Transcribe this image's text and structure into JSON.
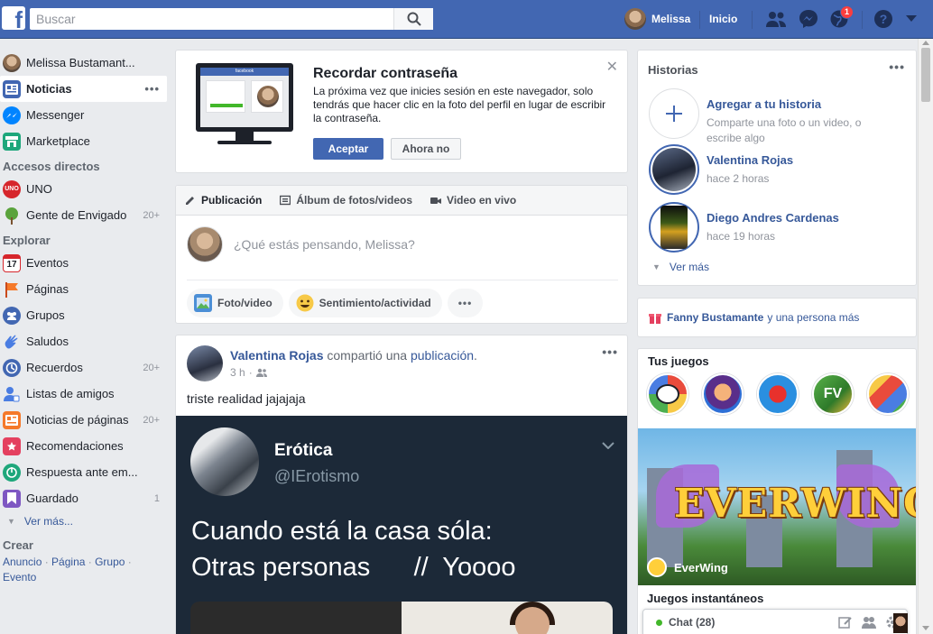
{
  "topbar": {
    "logo": "f",
    "search_placeholder": "Buscar",
    "user_name": "Melissa",
    "home_label": "Inicio",
    "notification_count": "1",
    "brand_color": "#4267b2"
  },
  "leftnav": {
    "profile_name": "Melissa Bustamant...",
    "main_items": [
      {
        "label": "Noticias",
        "icon": "news-feed-icon"
      },
      {
        "label": "Messenger",
        "icon": "messenger-icon"
      },
      {
        "label": "Marketplace",
        "icon": "marketplace-icon"
      }
    ],
    "shortcuts_title": "Accesos directos",
    "shortcuts": [
      {
        "label": "UNO",
        "icon": "uno-game-icon",
        "count": ""
      },
      {
        "label": "Gente de Envigado",
        "icon": "group-tree-icon",
        "count": "20+"
      }
    ],
    "explore_title": "Explorar",
    "explore": [
      {
        "label": "Eventos",
        "icon": "calendar-icon",
        "count": ""
      },
      {
        "label": "Páginas",
        "icon": "flag-icon",
        "count": ""
      },
      {
        "label": "Grupos",
        "icon": "groups-icon",
        "count": ""
      },
      {
        "label": "Saludos",
        "icon": "wave-icon",
        "count": ""
      },
      {
        "label": "Recuerdos",
        "icon": "memories-icon",
        "count": "20+"
      },
      {
        "label": "Listas de amigos",
        "icon": "friend-list-icon",
        "count": ""
      },
      {
        "label": "Noticias de páginas",
        "icon": "pages-feed-icon",
        "count": "20+"
      },
      {
        "label": "Recomendaciones",
        "icon": "recommendations-icon",
        "count": ""
      },
      {
        "label": "Respuesta ante em...",
        "icon": "crisis-response-icon",
        "count": ""
      },
      {
        "label": "Guardado",
        "icon": "saved-icon",
        "count": "1"
      }
    ],
    "see_more": "Ver más...",
    "create_title": "Crear",
    "create_links": [
      "Anuncio",
      "Página",
      "Grupo",
      "Evento"
    ]
  },
  "recordar": {
    "title": "Recordar contraseña",
    "body": "La próxima vez que inicies sesión en este navegador, solo tendrás que hacer clic en la foto del perfil en lugar de escribir la contraseña.",
    "accept": "Aceptar",
    "not_now": "Ahora no",
    "monitor_brand": "facebook"
  },
  "composer": {
    "tabs": [
      "Publicación",
      "Álbum de fotos/videos",
      "Video en vivo"
    ],
    "placeholder": "¿Qué estás pensando, Melissa?",
    "actions": [
      "Foto/video",
      "Sentimiento/actividad"
    ]
  },
  "post": {
    "author": "Valentina Rojas",
    "action_prefix": " compartió una ",
    "action_link": "publicación",
    "action_suffix": ".",
    "time": "3 h",
    "text": "triste realidad jajajaja",
    "tweet": {
      "name": "Erótica",
      "handle": "@IErotismo",
      "line1": "Cuando está la casa sóla:",
      "line2": "Otras personas      //  Yoooo"
    }
  },
  "historias": {
    "title": "Historias",
    "add_title": "Agregar a tu historia",
    "add_sub": "Comparte una foto o un video, o escribe algo",
    "stories": [
      {
        "name": "Valentina Rojas",
        "time": "hace 2 horas"
      },
      {
        "name": "Diego Andres Cardenas",
        "time": "hace 19 horas"
      }
    ],
    "see_more": "Ver más"
  },
  "birthday": {
    "name": "Fanny Bustamante",
    "rest": "y una persona más"
  },
  "juegos": {
    "title": "Tus juegos",
    "featured_name": "EverWing",
    "banner_logo": "EVERWING",
    "instant_title": "Juegos instantáneos"
  },
  "chat": {
    "label": "Chat (28)"
  }
}
